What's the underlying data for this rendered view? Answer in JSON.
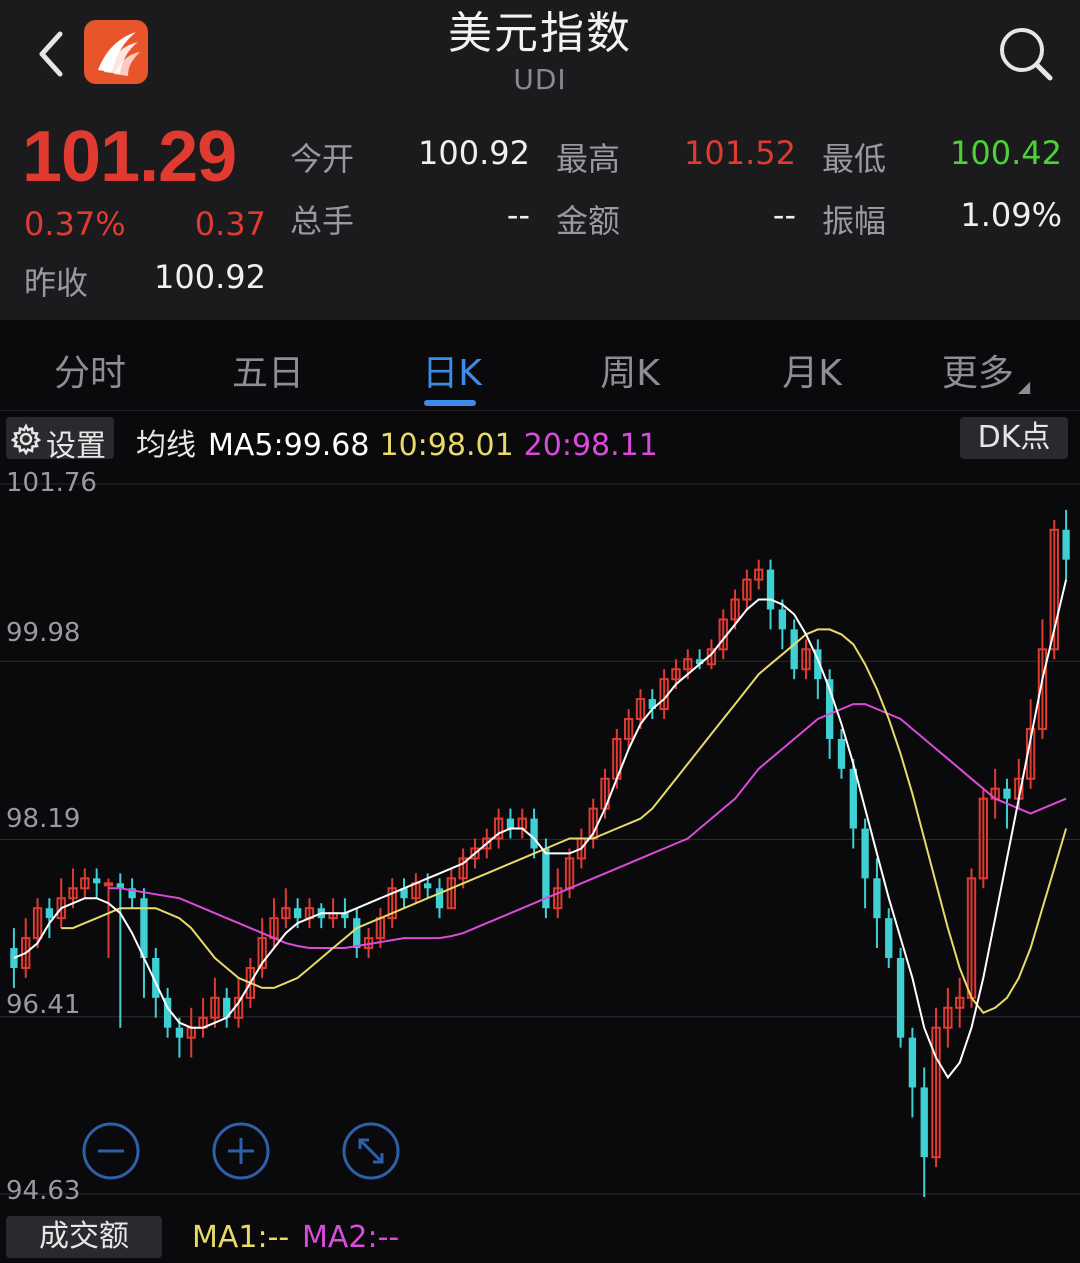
{
  "header": {
    "title": "美元指数",
    "subtitle": "UDI"
  },
  "quote": {
    "price": "101.29",
    "change_pct": "0.37%",
    "change_abs": "0.37",
    "prev_close_label": "昨收",
    "prev_close": "100.92",
    "open_label": "今开",
    "open": "100.92",
    "high_label": "最高",
    "high": "101.52",
    "low_label": "最低",
    "low": "100.42",
    "volume_label": "总手",
    "volume": "--",
    "amount_label": "金额",
    "amount": "--",
    "amplitude_label": "振幅",
    "amplitude": "1.09%"
  },
  "tabs": [
    {
      "label": "分时"
    },
    {
      "label": "五日"
    },
    {
      "label": "日K",
      "active": true
    },
    {
      "label": "周K"
    },
    {
      "label": "月K"
    },
    {
      "label": "更多"
    }
  ],
  "ma_bar": {
    "settings_label": "设置",
    "ma_title": "均线",
    "ma5": "MA5:99.68",
    "ma10": "10:98.01",
    "ma20": "20:98.11",
    "dk_label": "DK点"
  },
  "volume_bar": {
    "label": "成交额",
    "ma1": "MA1:--",
    "ma2": "MA2:--"
  },
  "colors": {
    "up": "#e03a31",
    "down": "#3fd0d4",
    "low_green": "#4cd137",
    "accent": "#3f8be8",
    "ma5": "#ffffff",
    "ma10": "#e8d96a",
    "ma20": "#d94bd9"
  },
  "chart_data": {
    "type": "candlestick",
    "y_ticks": [
      "101.76",
      "99.98",
      "98.19",
      "96.41",
      "94.63"
    ],
    "ylim": [
      94.63,
      101.76
    ],
    "grid": true,
    "candles": [
      [
        97.1,
        96.9,
        97.3,
        96.7
      ],
      [
        96.9,
        97.2,
        97.4,
        96.8
      ],
      [
        97.2,
        97.5,
        97.6,
        97.1
      ],
      [
        97.5,
        97.4,
        97.6,
        97.2
      ],
      [
        97.4,
        97.6,
        97.8,
        97.3
      ],
      [
        97.6,
        97.7,
        97.9,
        97.5
      ],
      [
        97.7,
        97.8,
        97.9,
        97.6
      ],
      [
        97.8,
        97.75,
        97.9,
        97.6
      ],
      [
        97.75,
        97.75,
        97.8,
        97.0
      ],
      [
        97.75,
        97.7,
        97.85,
        96.3
      ],
      [
        97.7,
        97.6,
        97.8,
        97.5
      ],
      [
        97.6,
        97.0,
        97.7,
        96.6
      ],
      [
        97.0,
        96.6,
        97.1,
        96.4
      ],
      [
        96.6,
        96.3,
        96.7,
        96.2
      ],
      [
        96.3,
        96.2,
        96.4,
        96.0
      ],
      [
        96.2,
        96.3,
        96.5,
        96.0
      ],
      [
        96.3,
        96.4,
        96.6,
        96.2
      ],
      [
        96.4,
        96.6,
        96.8,
        96.3
      ],
      [
        96.6,
        96.4,
        96.7,
        96.3
      ],
      [
        96.4,
        96.6,
        96.8,
        96.3
      ],
      [
        96.6,
        96.9,
        97.0,
        96.5
      ],
      [
        96.9,
        97.2,
        97.4,
        96.8
      ],
      [
        97.2,
        97.4,
        97.6,
        97.1
      ],
      [
        97.4,
        97.5,
        97.7,
        97.3
      ],
      [
        97.5,
        97.4,
        97.6,
        97.3
      ],
      [
        97.4,
        97.5,
        97.6,
        97.3
      ],
      [
        97.5,
        97.4,
        97.55,
        97.3
      ],
      [
        97.4,
        97.45,
        97.6,
        97.3
      ],
      [
        97.45,
        97.4,
        97.6,
        97.3
      ],
      [
        97.4,
        97.1,
        97.5,
        97.0
      ],
      [
        97.1,
        97.2,
        97.3,
        97.0
      ],
      [
        97.2,
        97.4,
        97.5,
        97.1
      ],
      [
        97.4,
        97.7,
        97.8,
        97.3
      ],
      [
        97.7,
        97.6,
        97.8,
        97.5
      ],
      [
        97.6,
        97.75,
        97.85,
        97.55
      ],
      [
        97.75,
        97.7,
        97.85,
        97.6
      ],
      [
        97.7,
        97.5,
        97.8,
        97.4
      ],
      [
        97.5,
        97.8,
        97.9,
        97.5
      ],
      [
        97.8,
        98.0,
        98.1,
        97.7
      ],
      [
        98.0,
        98.1,
        98.2,
        97.9
      ],
      [
        98.1,
        98.2,
        98.3,
        98.0
      ],
      [
        98.2,
        98.4,
        98.5,
        98.1
      ],
      [
        98.4,
        98.3,
        98.5,
        98.2
      ],
      [
        98.3,
        98.4,
        98.5,
        98.2
      ],
      [
        98.4,
        98.1,
        98.5,
        98.0
      ],
      [
        98.1,
        97.5,
        98.2,
        97.4
      ],
      [
        97.5,
        97.7,
        97.9,
        97.4
      ],
      [
        97.7,
        98.0,
        98.1,
        97.6
      ],
      [
        98.0,
        98.2,
        98.3,
        97.9
      ],
      [
        98.2,
        98.5,
        98.6,
        98.1
      ],
      [
        98.5,
        98.8,
        98.9,
        98.4
      ],
      [
        98.8,
        99.2,
        99.3,
        98.7
      ],
      [
        99.2,
        99.4,
        99.5,
        99.1
      ],
      [
        99.4,
        99.6,
        99.7,
        99.3
      ],
      [
        99.6,
        99.5,
        99.7,
        99.4
      ],
      [
        99.5,
        99.8,
        99.9,
        99.4
      ],
      [
        99.8,
        99.9,
        100.0,
        99.7
      ],
      [
        99.9,
        100.0,
        100.1,
        99.8
      ],
      [
        100.0,
        99.95,
        100.1,
        99.9
      ],
      [
        99.95,
        100.1,
        100.2,
        99.9
      ],
      [
        100.1,
        100.4,
        100.5,
        100.0
      ],
      [
        100.4,
        100.6,
        100.7,
        100.3
      ],
      [
        100.6,
        100.8,
        100.9,
        100.5
      ],
      [
        100.8,
        100.9,
        101.0,
        100.7
      ],
      [
        100.9,
        100.5,
        101.0,
        100.3
      ],
      [
        100.5,
        100.3,
        100.6,
        100.1
      ],
      [
        100.3,
        99.9,
        100.4,
        99.8
      ],
      [
        99.9,
        100.1,
        100.2,
        99.8
      ],
      [
        100.1,
        99.8,
        100.2,
        99.6
      ],
      [
        99.8,
        99.2,
        99.9,
        99.0
      ],
      [
        99.2,
        98.9,
        99.3,
        98.8
      ],
      [
        98.9,
        98.3,
        99.0,
        98.1
      ],
      [
        98.3,
        97.8,
        98.4,
        97.5
      ],
      [
        97.8,
        97.4,
        98.0,
        97.1
      ],
      [
        97.4,
        97.0,
        97.5,
        96.9
      ],
      [
        97.0,
        96.2,
        97.1,
        96.1
      ],
      [
        96.2,
        95.7,
        96.3,
        95.4
      ],
      [
        95.7,
        95.0,
        95.9,
        94.6
      ],
      [
        95.0,
        96.3,
        96.5,
        94.9
      ],
      [
        96.3,
        96.5,
        96.7,
        96.1
      ],
      [
        96.5,
        96.6,
        96.8,
        96.3
      ],
      [
        96.6,
        97.8,
        97.9,
        96.5
      ],
      [
        97.8,
        98.6,
        98.7,
        97.7
      ],
      [
        98.6,
        98.7,
        98.9,
        98.4
      ],
      [
        98.7,
        98.6,
        98.8,
        98.3
      ],
      [
        98.6,
        98.8,
        99.0,
        98.5
      ],
      [
        98.8,
        99.3,
        99.6,
        98.7
      ],
      [
        99.3,
        100.1,
        100.4,
        99.2
      ],
      [
        100.1,
        101.3,
        101.4,
        100.0
      ],
      [
        101.3,
        101.0,
        101.5,
        100.8
      ]
    ],
    "ma5": [
      97.0,
      97.05,
      97.15,
      97.35,
      97.5,
      97.55,
      97.6,
      97.6,
      97.55,
      97.45,
      97.25,
      97.0,
      96.75,
      96.5,
      96.35,
      96.3,
      96.3,
      96.35,
      96.4,
      96.55,
      96.75,
      96.95,
      97.1,
      97.25,
      97.35,
      97.4,
      97.45,
      97.45,
      97.45,
      97.5,
      97.55,
      97.6,
      97.65,
      97.7,
      97.75,
      97.8,
      97.85,
      97.9,
      97.95,
      98.05,
      98.15,
      98.25,
      98.3,
      98.3,
      98.2,
      98.05,
      98.05,
      98.05,
      98.1,
      98.25,
      98.5,
      98.8,
      99.1,
      99.35,
      99.5,
      99.6,
      99.75,
      99.85,
      99.95,
      100.05,
      100.2,
      100.35,
      100.5,
      100.6,
      100.6,
      100.55,
      100.45,
      100.25,
      100.0,
      99.7,
      99.35,
      98.95,
      98.5,
      98.05,
      97.6,
      97.2,
      96.8,
      96.3,
      96.0,
      95.8,
      95.95,
      96.3,
      96.8,
      97.4,
      98.0,
      98.6,
      99.2,
      99.8,
      100.3,
      100.8
    ],
    "ma10": [
      97.3,
      97.3,
      97.35,
      97.4,
      97.45,
      97.5,
      97.5,
      97.5,
      97.5,
      97.45,
      97.4,
      97.3,
      97.15,
      97.0,
      96.9,
      96.8,
      96.75,
      96.7,
      96.7,
      96.75,
      96.8,
      96.9,
      97.0,
      97.1,
      97.2,
      97.3,
      97.35,
      97.4,
      97.45,
      97.5,
      97.55,
      97.6,
      97.65,
      97.7,
      97.75,
      97.8,
      97.85,
      97.9,
      97.95,
      98.0,
      98.05,
      98.1,
      98.15,
      98.2,
      98.2,
      98.2,
      98.25,
      98.3,
      98.35,
      98.4,
      98.5,
      98.65,
      98.8,
      98.95,
      99.1,
      99.25,
      99.4,
      99.55,
      99.7,
      99.85,
      99.95,
      100.05,
      100.15,
      100.25,
      100.3,
      100.3,
      100.25,
      100.15,
      99.95,
      99.7,
      99.4,
      99.05,
      98.65,
      98.2,
      97.75,
      97.3,
      96.9,
      96.6,
      96.45,
      96.5,
      96.6,
      96.8,
      97.1,
      97.5,
      97.9,
      98.3
    ],
    "ma20": [
      97.7,
      97.7,
      97.68,
      97.66,
      97.64,
      97.62,
      97.6,
      97.55,
      97.5,
      97.45,
      97.4,
      97.35,
      97.3,
      97.25,
      97.2,
      97.15,
      97.12,
      97.1,
      97.1,
      97.1,
      97.1,
      97.12,
      97.14,
      97.16,
      97.18,
      97.2,
      97.2,
      97.2,
      97.2,
      97.22,
      97.25,
      97.3,
      97.35,
      97.4,
      97.45,
      97.5,
      97.55,
      97.6,
      97.65,
      97.7,
      97.75,
      97.8,
      97.85,
      97.9,
      97.95,
      98.0,
      98.05,
      98.1,
      98.15,
      98.2,
      98.3,
      98.4,
      98.5,
      98.6,
      98.75,
      98.9,
      99.0,
      99.1,
      99.2,
      99.3,
      99.4,
      99.45,
      99.5,
      99.55,
      99.55,
      99.5,
      99.45,
      99.4,
      99.3,
      99.2,
      99.1,
      99.0,
      98.9,
      98.8,
      98.7,
      98.6,
      98.55,
      98.5,
      98.45,
      98.5,
      98.55,
      98.6
    ]
  }
}
